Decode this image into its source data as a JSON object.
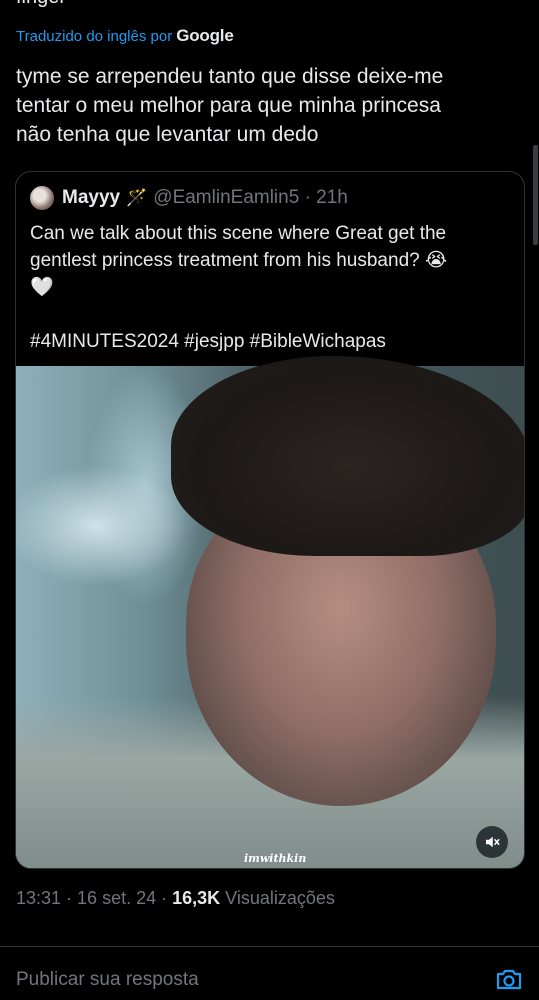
{
  "previous_text_tail": "finger",
  "translation": {
    "label": "Traduzido do inglês por",
    "provider": "Google"
  },
  "tweet": {
    "lines": [
      "tyme se arrependeu tanto que disse deixe-me",
      "tentar o meu melhor para que minha princesa",
      "não tenha que levantar um dedo"
    ]
  },
  "quoted": {
    "name": "Mayyy",
    "name_emoji": "🪄",
    "handle_time": "@EamlinEamlin5 · 21h",
    "lines": [
      "Can we talk about this scene where Great get the",
      "gentlest princess treatment from his husband? 😭",
      "🤍",
      "",
      "#4MINUTES2024 #jesjpp #BibleWichapas"
    ],
    "media_watermark": "imwithkin"
  },
  "meta": {
    "time_date": "13:31 · 16 set. 24 · ",
    "views_count": "16,3K",
    "views_label": " Visualizações"
  },
  "reply": {
    "placeholder": "Publicar sua resposta"
  },
  "icons": {
    "mute": "volume-muted-icon",
    "camera": "camera-icon"
  },
  "colors": {
    "accent": "#1d9bf0",
    "text": "#e7e9ea",
    "muted": "#71767b",
    "border": "#2f3336"
  }
}
